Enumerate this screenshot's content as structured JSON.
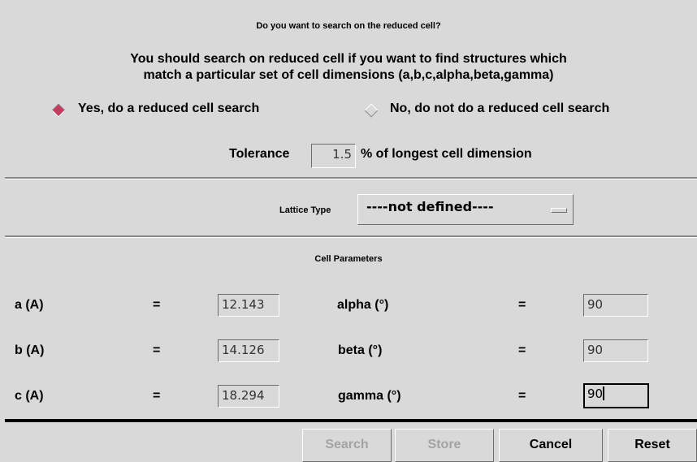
{
  "reduced_cell": {
    "question": "Do you want to search on the reduced cell?",
    "explanation_line1": "You should search on reduced cell if you want to find structures which",
    "explanation_line2": "match a particular set of cell dimensions (a,b,c,alpha,beta,gamma)",
    "option_yes": "Yes, do a reduced cell search",
    "option_no": "No, do not do a reduced cell search",
    "selected": "yes",
    "tolerance_label": "Tolerance",
    "tolerance_value": "1.5",
    "tolerance_suffix": "% of longest cell dimension"
  },
  "lattice": {
    "label": "Lattice Type",
    "selected": "----not defined----"
  },
  "cell_parameters": {
    "title": "Cell Parameters",
    "equals": "=",
    "rows": [
      {
        "left_label": "a (A)",
        "left_value": "12.143",
        "right_label": "alpha (°)",
        "right_value": "90"
      },
      {
        "left_label": "b (A)",
        "left_value": "14.126",
        "right_label": "beta (°)",
        "right_value": "90"
      },
      {
        "left_label": "c (A)",
        "left_value": "18.294",
        "right_label": "gamma (°)",
        "right_value": "90"
      }
    ]
  },
  "buttons": {
    "search": "Search",
    "store": "Store",
    "cancel": "Cancel",
    "reset": "Reset"
  },
  "colors": {
    "background": "#d9d9d9",
    "radio_selected": "#c23c5f",
    "disabled_text": "#a3a3a3"
  }
}
